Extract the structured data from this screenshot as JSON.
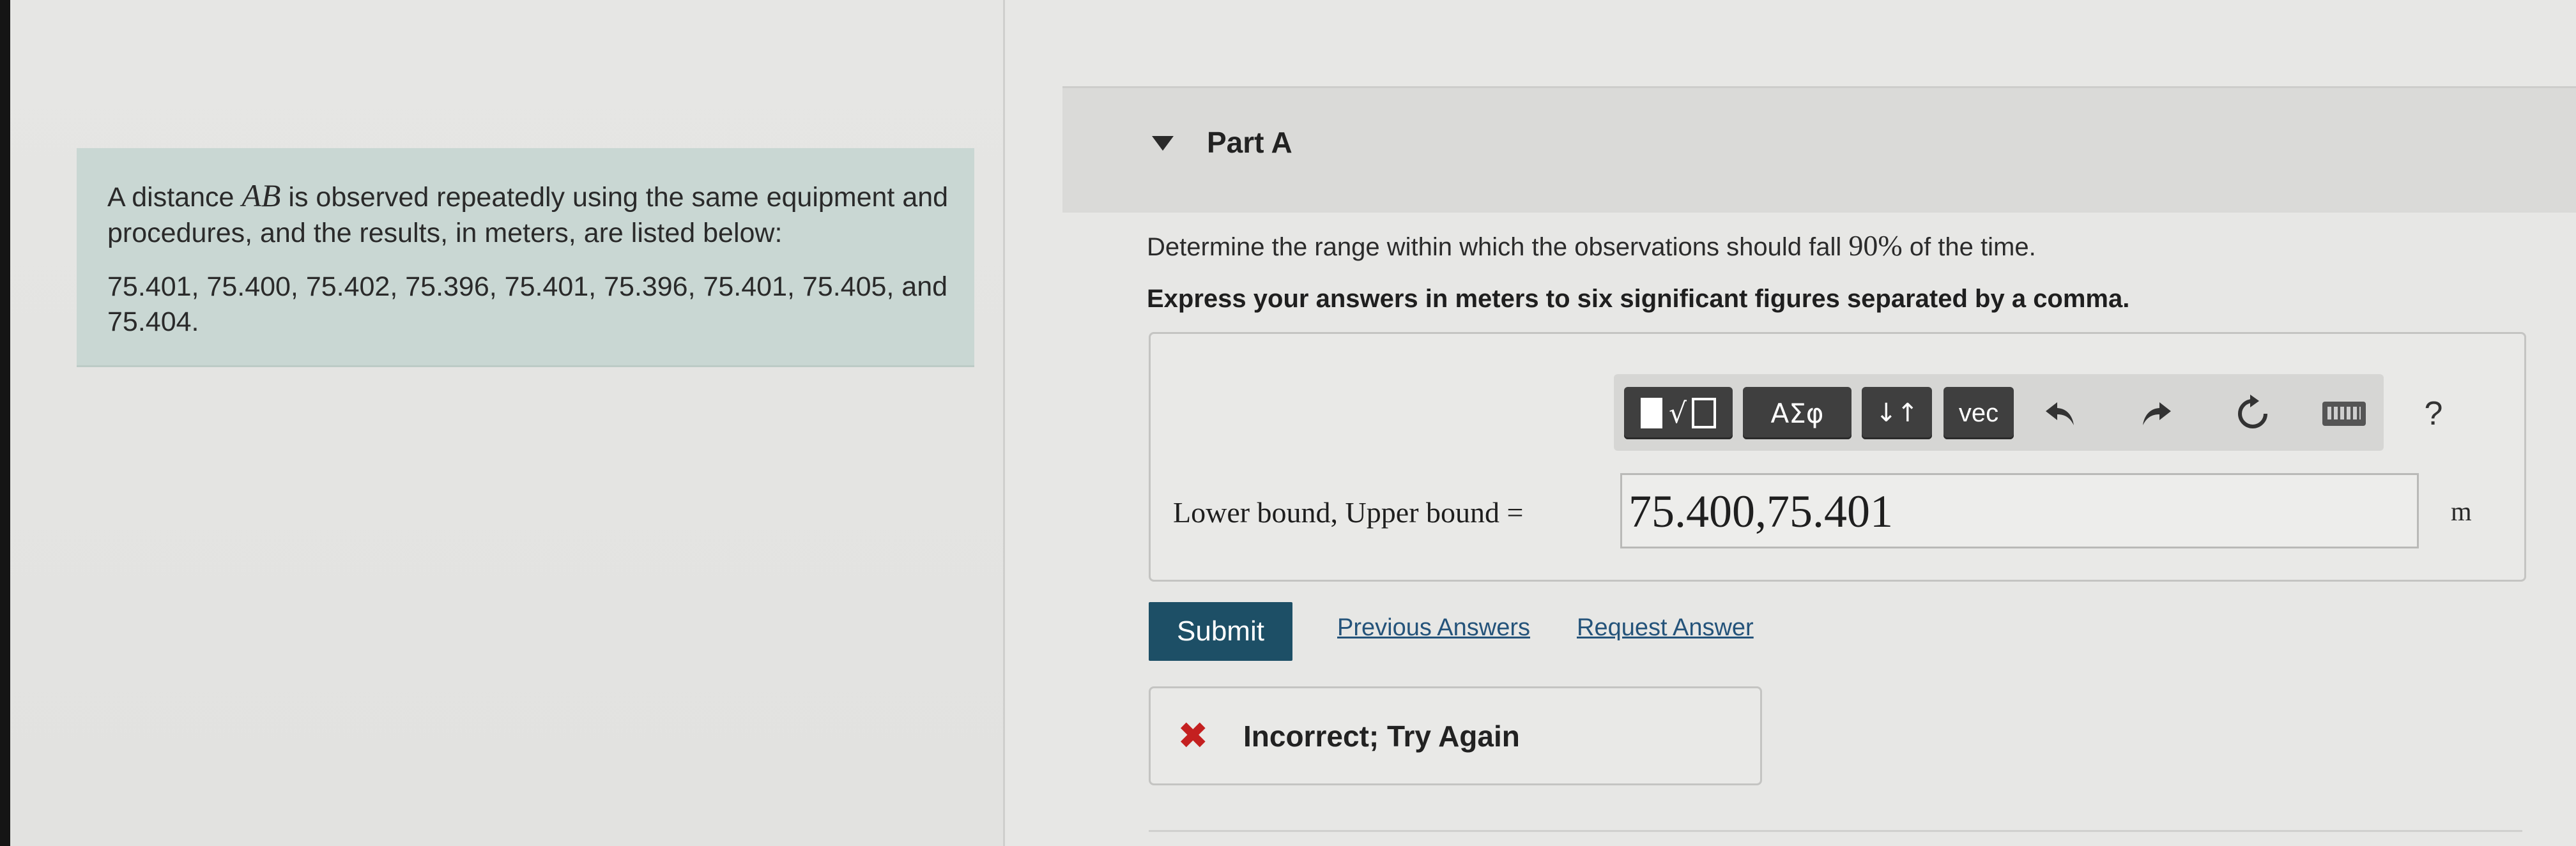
{
  "problem": {
    "line_prefix": "A distance ",
    "variable": "AB",
    "line_suffix": " is observed repeatedly using the same equipment and procedures, and the results, in meters, are listed below:",
    "values": "75.401, 75.400, 75.402, 75.396, 75.401, 75.396, 75.401, 75.405, and 75.404."
  },
  "part": {
    "title": "Part A"
  },
  "question": {
    "text_before": "Determine the range within which the observations should fall ",
    "percent": "90%",
    "text_after": " of the time.",
    "instruction": "Express your answers in meters to six significant figures separated by a comma."
  },
  "toolbar": {
    "template_radical": "√",
    "greek_label": "ΑΣφ",
    "arrows_label": "↓↑",
    "vec_label": "vec",
    "help_label": "?",
    "icons": [
      "undo-icon",
      "redo-icon",
      "reset-icon",
      "keyboard-icon"
    ]
  },
  "answer": {
    "label": "Lower bound, Upper bound =",
    "value": "75.400,75.401",
    "unit": "m"
  },
  "actions": {
    "submit": "Submit",
    "previous_answers": "Previous Answers",
    "request_answer": "Request Answer"
  },
  "feedback": {
    "text": "Incorrect; Try Again",
    "icon_color": "#c42020"
  },
  "colors": {
    "problem_box": "#c9d7d3",
    "submit": "#1d4f66",
    "link": "#24537a"
  }
}
